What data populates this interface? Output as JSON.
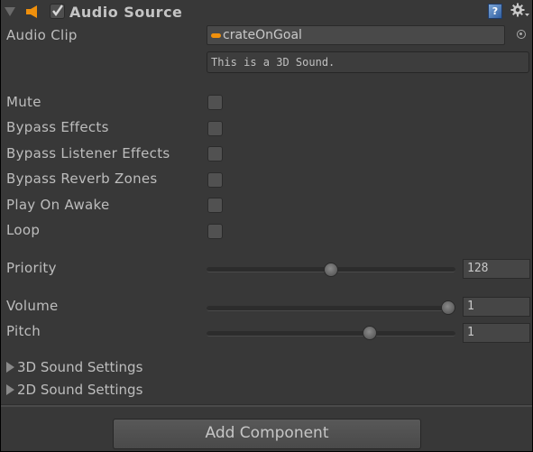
{
  "component": {
    "title": "Audio Source",
    "enabled": true,
    "expanded": true,
    "icons": {
      "foldout": "triangle-down-icon",
      "component": "speaker-icon",
      "help": "help-book-icon",
      "settings": "gear-icon"
    }
  },
  "audio_clip": {
    "label": "Audio Clip",
    "value": "crateOnGoal",
    "info": "This is a 3D Sound."
  },
  "toggles": [
    {
      "label": "Mute",
      "checked": false
    },
    {
      "label": "Bypass Effects",
      "checked": false
    },
    {
      "label": "Bypass Listener Effects",
      "checked": false
    },
    {
      "label": "Bypass Reverb Zones",
      "checked": false
    },
    {
      "label": "Play On Awake",
      "checked": false
    },
    {
      "label": "Loop",
      "checked": false
    }
  ],
  "sliders": {
    "priority": {
      "label": "Priority",
      "value": "128",
      "min": 0,
      "max": 256,
      "fraction": 0.5
    },
    "volume": {
      "label": "Volume",
      "value": "1",
      "min": 0,
      "max": 1,
      "fraction": 1.0
    },
    "pitch": {
      "label": "Pitch",
      "value": "1",
      "min": -3,
      "max": 3,
      "fraction": 0.667
    }
  },
  "foldouts": [
    {
      "label": "3D Sound Settings",
      "expanded": false
    },
    {
      "label": "2D Sound Settings",
      "expanded": false
    }
  ],
  "add_component_label": "Add Component",
  "colors": {
    "panel_bg": "#383838",
    "accent_orange": "#f0900c",
    "text": "#bdbdbd"
  }
}
